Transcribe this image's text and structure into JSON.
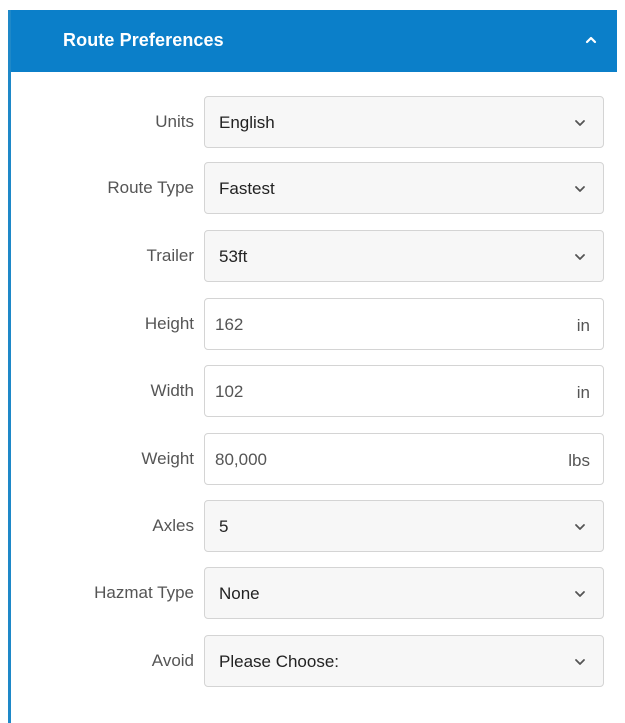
{
  "panel": {
    "title": "Route Preferences",
    "header_color": "#0b7fc9",
    "collapse_icon": "chevron-up-icon"
  },
  "fields": [
    {
      "key": "units",
      "label": "Units",
      "type": "select",
      "value": "English"
    },
    {
      "key": "route_type",
      "label": "Route Type",
      "type": "select",
      "value": "Fastest"
    },
    {
      "key": "trailer",
      "label": "Trailer",
      "type": "select",
      "value": "53ft"
    },
    {
      "key": "height",
      "label": "Height",
      "type": "input",
      "value": "162",
      "unit": "in"
    },
    {
      "key": "width",
      "label": "Width",
      "type": "input",
      "value": "102",
      "unit": "in"
    },
    {
      "key": "weight",
      "label": "Weight",
      "type": "input",
      "value": "80,000",
      "unit": "lbs"
    },
    {
      "key": "axles",
      "label": "Axles",
      "type": "select",
      "value": "5"
    },
    {
      "key": "hazmat_type",
      "label": "Hazmat Type",
      "type": "select",
      "value": "None"
    },
    {
      "key": "avoid",
      "label": "Avoid",
      "type": "select",
      "value": "Please Choose:"
    }
  ]
}
